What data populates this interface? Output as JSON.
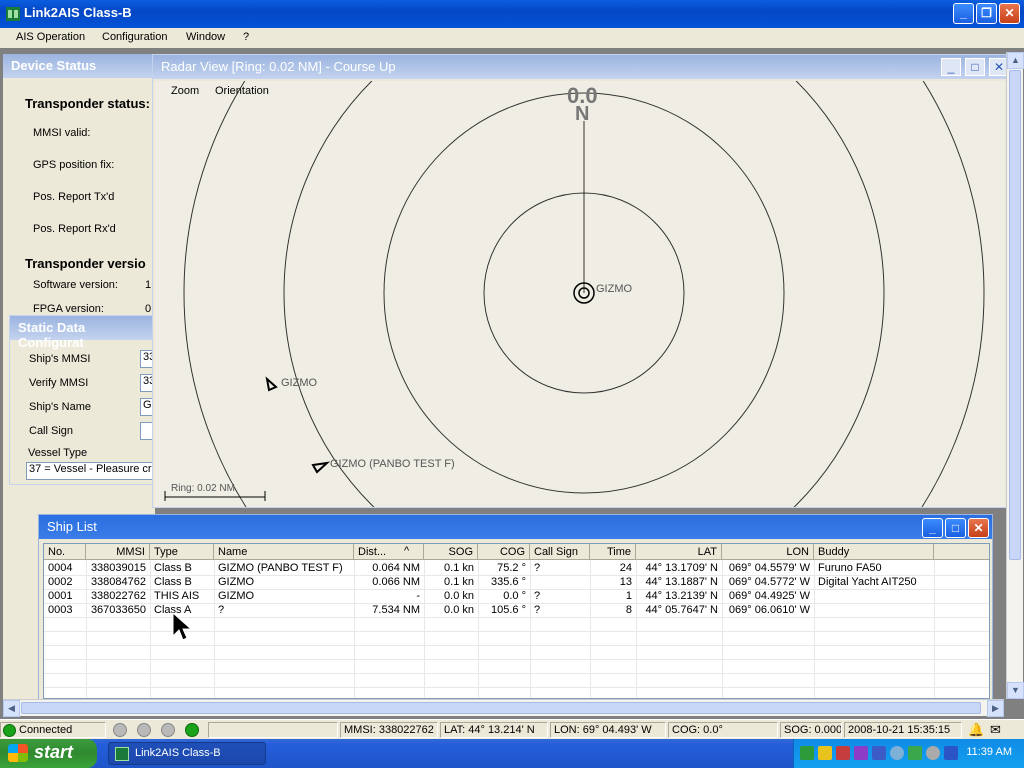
{
  "app": {
    "title": "Link2AIS Class-B"
  },
  "menu": [
    "AIS Operation",
    "Configuration",
    "Window",
    "?"
  ],
  "device_status": {
    "title": "Device Status",
    "transponder_status_heading": "Transponder status:",
    "mmsi_valid": "MMSI valid:",
    "gps_fix": "GPS position fix:",
    "pos_tx": "Pos. Report Tx'd",
    "pos_rx": "Pos. Report Rx'd",
    "transponder_version_heading": "Transponder versio",
    "software_version": "Software version:",
    "software_value": "1",
    "fpga_version": "FPGA version:",
    "fpga_value": "0"
  },
  "static_data": {
    "title": "Static Data Configurat",
    "ships_mmsi_label": "Ship's MMSI",
    "ships_mmsi_value": "33",
    "verify_mmsi_label": "Verify MMSI",
    "verify_mmsi_value": "33",
    "ships_name_label": "Ship's Name",
    "ships_name_value": "G",
    "call_sign_label": "Call Sign",
    "call_sign_value": "",
    "vessel_type_label": "Vessel Type",
    "vessel_type_value": "37 = Vessel - Pleasure cra"
  },
  "radar": {
    "title": "Radar View [Ring: 0.02 NM] - Course Up",
    "menu_zoom": "Zoom",
    "menu_orientation": "Orientation",
    "heading_value": "0.0",
    "north_label": "N",
    "own_ship_label": "GIZMO",
    "target1_label": "GIZMO",
    "target2_label": "GIZMO (PANBO TEST F)",
    "ring_scale_label": "Ring: 0.02 NM"
  },
  "ship_list": {
    "title": "Ship List",
    "columns": [
      "No.",
      "MMSI",
      "Type",
      "Name",
      "Dist...",
      "SOG",
      "COG",
      "Call Sign",
      "Time",
      "LAT",
      "LON",
      "Buddy"
    ],
    "sort_indicator": "^",
    "rows": [
      [
        "0004",
        "338039015",
        "Class B",
        "GIZMO (PANBO TEST F)",
        "0.064 NM",
        "0.1 kn",
        "75.2 °",
        "?",
        "24",
        "44° 13.1709' N",
        "069° 04.5579' W",
        "Furuno FA50"
      ],
      [
        "0002",
        "338084762",
        "Class B",
        "GIZMO",
        "0.066 NM",
        "0.1 kn",
        "335.6 °",
        "",
        "13",
        "44° 13.1887' N",
        "069° 04.5772' W",
        "Digital Yacht AIT250"
      ],
      [
        "0001",
        "338022762",
        "THIS AIS",
        "GIZMO",
        "-",
        "0.0 kn",
        "0.0 °",
        "?",
        "1",
        "44° 13.2139' N",
        "069° 04.4925' W",
        ""
      ],
      [
        "0003",
        "367033650",
        "Class A",
        "?",
        "7.534 NM",
        "0.0 kn",
        "105.6 °",
        "?",
        "8",
        "44° 05.7647' N",
        "069° 06.0610' W",
        ""
      ]
    ]
  },
  "statusbar": {
    "connected": "Connected",
    "mmsi": "MMSI: 338022762",
    "lat": "LAT: 44° 13.214' N",
    "lon": "LON: 69° 04.493' W",
    "cog": "COG: 0.0°",
    "sog": "SOG: 0.000 kn",
    "datetime": "2008-10-21  15:35:15"
  },
  "taskbar": {
    "start": "start",
    "task": "Link2AIS Class-B",
    "clock": "11:39 AM"
  },
  "colors": {
    "accent": "#0a5ee0",
    "radar_bg": "#f0eee4",
    "status_ok": "#1aa31a"
  }
}
